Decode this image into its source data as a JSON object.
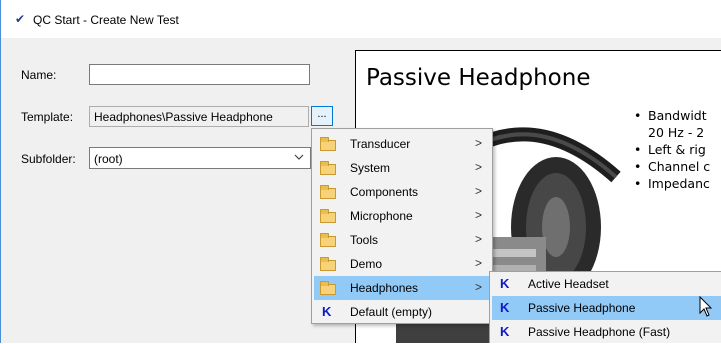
{
  "window": {
    "title": "QC Start - Create New Test"
  },
  "form": {
    "name_label": "Name:",
    "name_value": "",
    "template_label": "Template:",
    "template_value": "Headphones\\Passive Headphone",
    "browse_label": "...",
    "subfolder_label": "Subfolder:",
    "subfolder_value": "(root)"
  },
  "preview": {
    "title": "Passive Headphone",
    "bullets": [
      {
        "line1": "Bandwidt",
        "line2": "20 Hz - 2"
      },
      {
        "line1": "Left & rig"
      },
      {
        "line1": "Channel c"
      },
      {
        "line1": "Impedanc"
      }
    ]
  },
  "menu": {
    "items": [
      {
        "label": "Transducer",
        "icon": "folder-icon",
        "submenu": true
      },
      {
        "label": "System",
        "icon": "folder-icon",
        "submenu": true
      },
      {
        "label": "Components",
        "icon": "folder-icon",
        "submenu": true
      },
      {
        "label": "Microphone",
        "icon": "folder-icon",
        "submenu": true
      },
      {
        "label": "Tools",
        "icon": "folder-icon",
        "submenu": true
      },
      {
        "label": "Demo",
        "icon": "folder-icon",
        "submenu": true
      },
      {
        "label": "Headphones",
        "icon": "folder-icon",
        "submenu": true,
        "highlighted": true
      },
      {
        "label": "Default (empty)",
        "icon": "k-template-icon",
        "submenu": false
      }
    ],
    "arrow_glyph": ">"
  },
  "submenu": {
    "items": [
      {
        "label": "Active Headset",
        "icon": "k-template-icon"
      },
      {
        "label": "Passive Headphone",
        "icon": "k-template-icon",
        "highlighted": true
      },
      {
        "label": "Passive Headphone (Fast)",
        "icon": "k-template-icon"
      }
    ],
    "icon_glyph": "K"
  },
  "colors": {
    "highlight": "#91c9f7",
    "k_icon": "#1018c8",
    "window_bg": "#f0f0f0"
  }
}
